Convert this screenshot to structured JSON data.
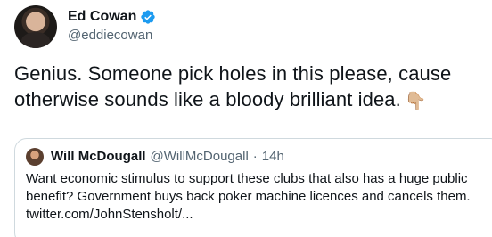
{
  "author": {
    "display_name": "Ed Cowan",
    "handle": "@eddiecowan",
    "avatar_icon": "profile-photo",
    "verified_icon": "verified-badge-icon"
  },
  "tweet": {
    "text": "Genius. Someone pick holes in this please, cause otherwise sounds like a bloody brilliant idea.",
    "emoji": "👇🏼"
  },
  "quoted_tweet": {
    "display_name": "Will McDougall",
    "handle": "@WillMcDougall",
    "separator": "·",
    "time": "14h",
    "text_line_1": "Want economic stimulus to support these clubs that also has a huge public",
    "text_line_2": "benefit? Government buys back poker machine licences and cancels them.",
    "text_line_3": "twitter.com/JohnStensholt/..."
  },
  "colors": {
    "verified_blue": "#1d9bf0",
    "secondary_text": "#536471",
    "border": "#cfd9de"
  }
}
